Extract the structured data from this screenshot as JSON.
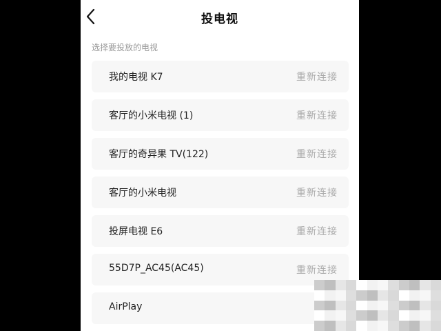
{
  "header": {
    "title": "投电视",
    "back_icon": "chevron-left-icon"
  },
  "section_hint": "选择要投放的电视",
  "devices": [
    {
      "name": "我的电视 K7",
      "action": "重新连接"
    },
    {
      "name": "客厅的小米电视 (1)",
      "action": "重新连接"
    },
    {
      "name": "客厅的奇异果 TV(122)",
      "action": "重新连接"
    },
    {
      "name": "客厅的小米电视",
      "action": "重新连接"
    },
    {
      "name": "投屏电视 E6",
      "action": "重新连接"
    },
    {
      "name": "55D7P_AC45(AC45)",
      "action": "重新连接"
    },
    {
      "name": "AirPlay",
      "action": ""
    }
  ],
  "colors": {
    "background": "#000000",
    "panel": "#ffffff",
    "item_background": "#f7f7f7",
    "primary_text": "#222222",
    "secondary_text": "#999999",
    "action_text": "#aaaaaa"
  }
}
